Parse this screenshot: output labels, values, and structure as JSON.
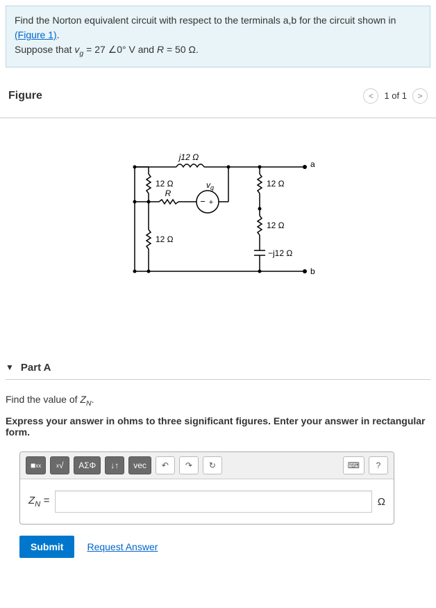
{
  "problem": {
    "intro": "Find the Norton equivalent circuit with respect to the terminals a,b for the circuit shown in ",
    "figure_link": "(Figure 1)",
    "period": ".",
    "suppose_prefix": "Suppose that ",
    "vg_sym": "v",
    "vg_sub": "g",
    "vg_val": " = 27 ∠0° V and ",
    "r_sym": "R",
    "r_val": " = 50 Ω."
  },
  "figure": {
    "title": "Figure",
    "count": "1 of 1",
    "labels": {
      "j12": "j12 Ω",
      "r12a": "12 Ω",
      "r12b": "12 Ω",
      "r12c": "12 Ω",
      "r12d": "12 Ω",
      "mj12": "−j12 Ω",
      "R": "R",
      "vg": "v",
      "vg_sub": "g",
      "a": "a",
      "b": "b",
      "plus": "+",
      "minus": "−"
    }
  },
  "part": {
    "label": "Part A",
    "question_prefix": "Find the value of ",
    "zn_sym": "Z",
    "zn_sub": "N",
    "period": ".",
    "instruction": "Express your answer in ohms to three significant figures. Enter your answer in rectangular form.",
    "input_label_sym": "Z",
    "input_label_sub": "N",
    "input_label_eq": " =",
    "unit": "Ω"
  },
  "toolbar": {
    "templates": "■",
    "root": "√",
    "greek": "ΑΣΦ",
    "subsup": "↓↑",
    "vec": "vec",
    "undo": "↶",
    "redo": "↷",
    "reset": "↻",
    "keyboard": "⌨",
    "help": "?"
  },
  "actions": {
    "submit": "Submit",
    "request": "Request Answer"
  }
}
